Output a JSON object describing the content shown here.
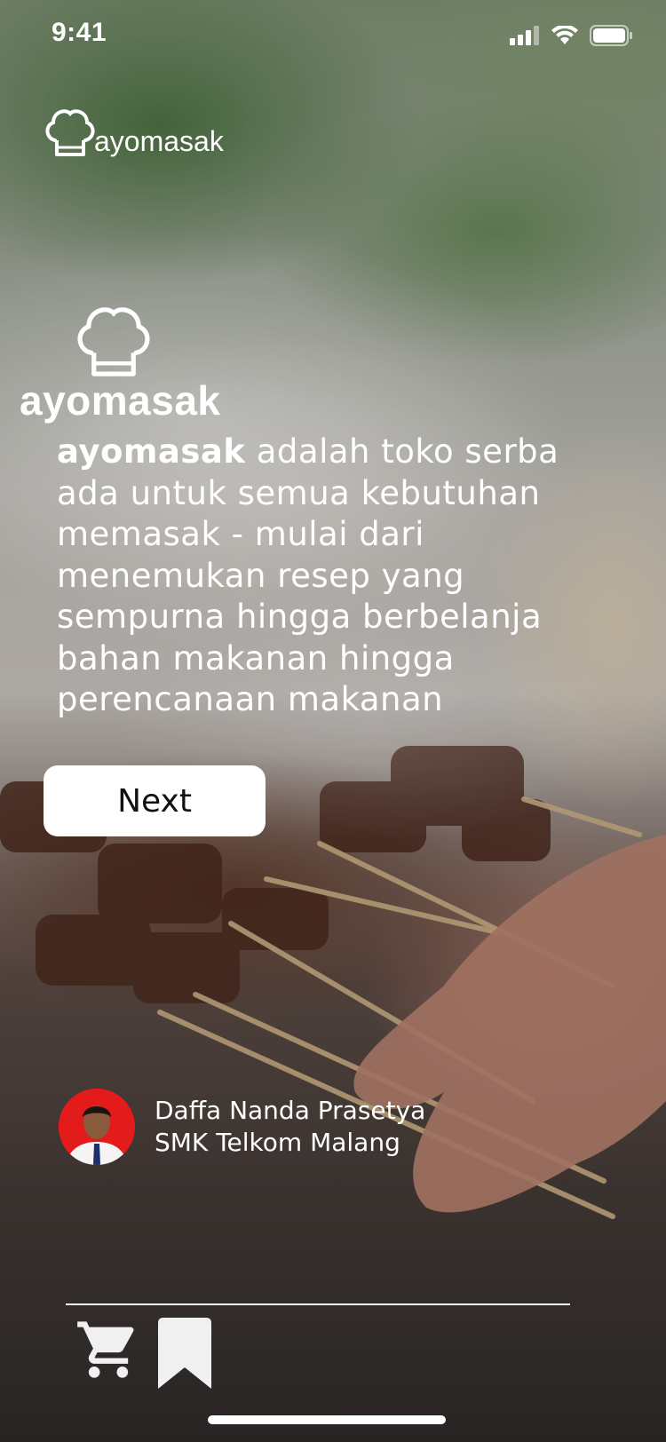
{
  "status_bar": {
    "time": "9:41"
  },
  "header": {
    "logo_text": "ayomasak"
  },
  "hero": {
    "logo_text": "ayomasak"
  },
  "description": {
    "brand": "ayomasak",
    "text": " adalah toko serba ada untuk semua kebutuhan memasak - mulai dari menemukan resep yang sempurna hingga berbelanja bahan makanan hingga perencanaan makanan"
  },
  "next_button": {
    "label": "Next"
  },
  "author": {
    "name": "Daffa Nanda Prasetya",
    "school": "SMK Telkom Malang"
  },
  "bottom_nav": {
    "items": [
      {
        "icon": "cart-icon"
      },
      {
        "icon": "bookmark-icon"
      }
    ]
  },
  "colors": {
    "button_bg": "#ffffff",
    "avatar_bg": "#e31b1b",
    "text": "#ffffff"
  }
}
